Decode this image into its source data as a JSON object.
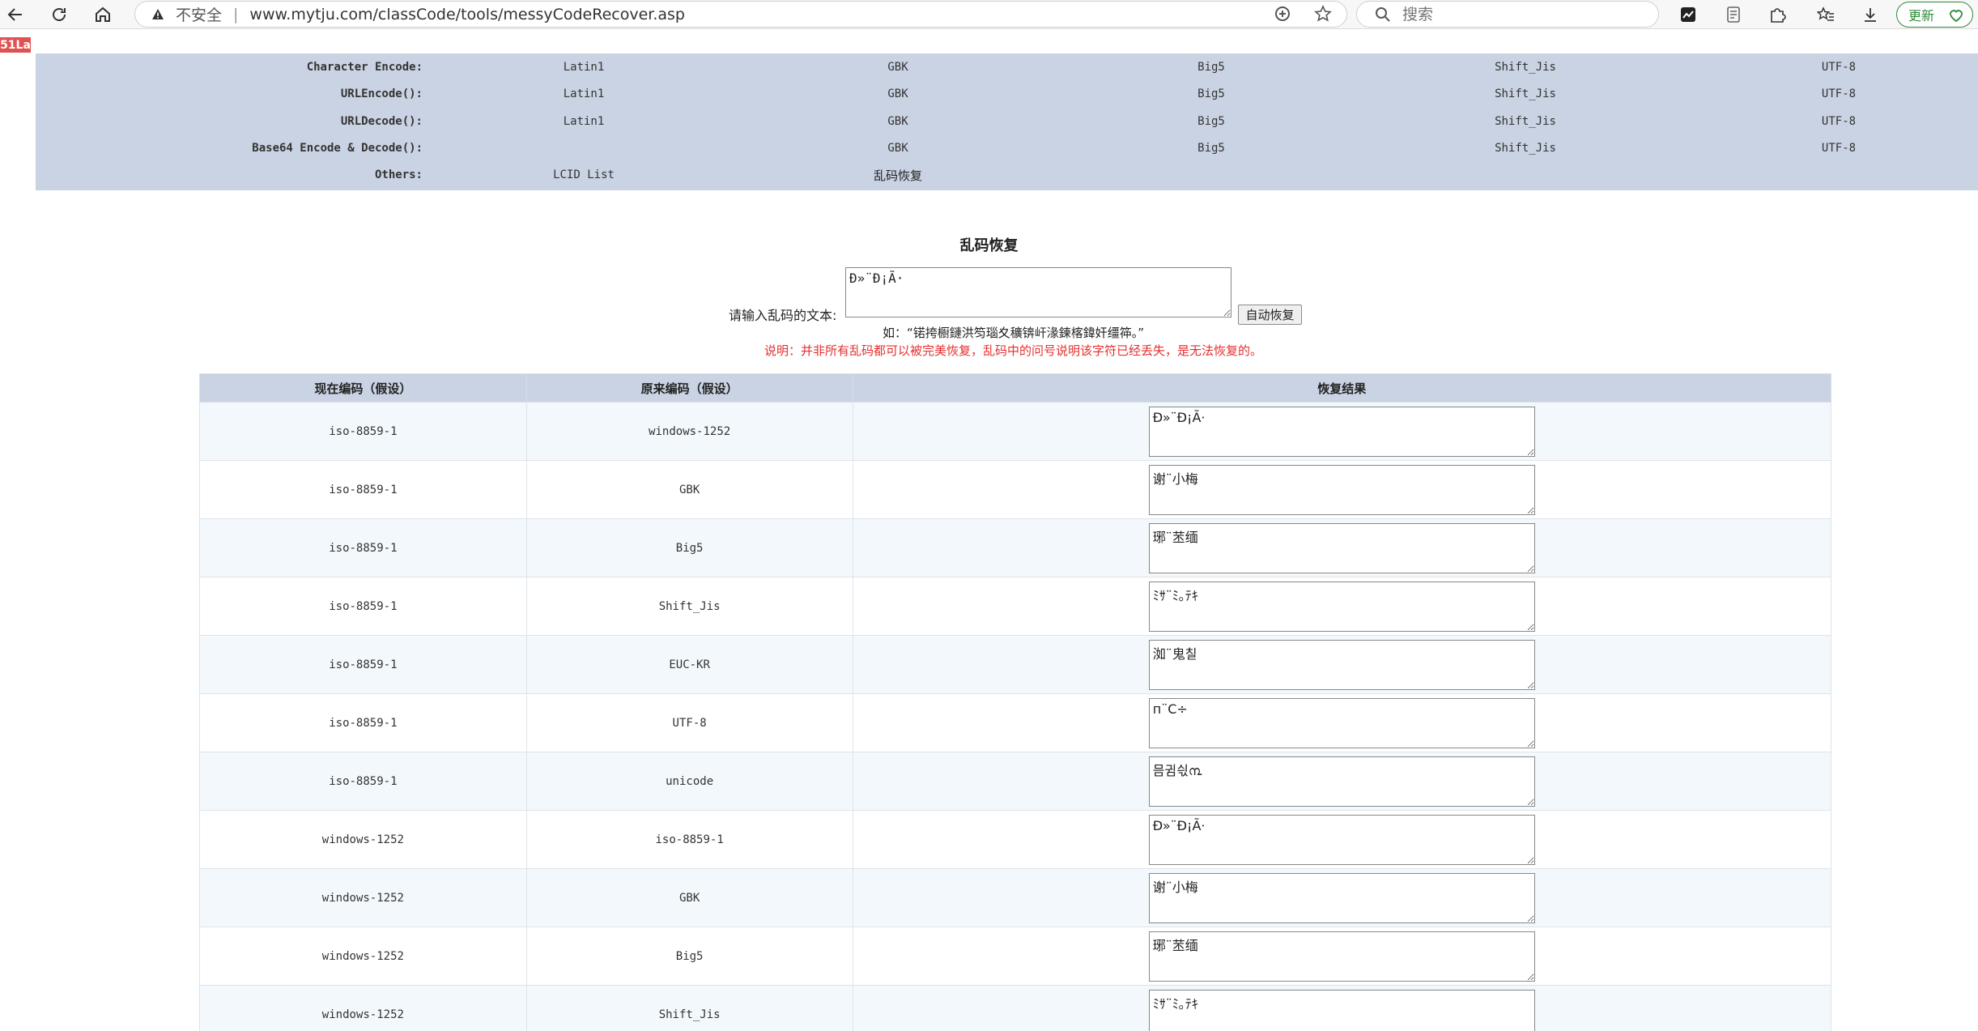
{
  "browser": {
    "insecure_label": "不安全",
    "separator": "|",
    "url": "www.mytju.com/classCode/tools/messyCodeRecover.asp",
    "search_placeholder": "搜索",
    "update_label": "更新"
  },
  "badge": "51La",
  "encode_nav": {
    "rows": [
      {
        "label": "Character Encode:",
        "cells": [
          "Latin1",
          "GBK",
          "Big5",
          "Shift_Jis",
          "UTF-8"
        ]
      },
      {
        "label": "URLEncode():",
        "cells": [
          "Latin1",
          "GBK",
          "Big5",
          "Shift_Jis",
          "UTF-8"
        ]
      },
      {
        "label": "URLDecode():",
        "cells": [
          "Latin1",
          "GBK",
          "Big5",
          "Shift_Jis",
          "UTF-8"
        ]
      },
      {
        "label": "Base64 Encode & Decode():",
        "cells": [
          "",
          "GBK",
          "Big5",
          "Shift_Jis",
          "UTF-8"
        ]
      },
      {
        "label": "Others:",
        "cells": [
          "LCID List",
          "乱码恢复",
          "",
          "",
          ""
        ]
      }
    ]
  },
  "tool": {
    "title": "乱码恢复",
    "input_label": "请输入乱码的文本:",
    "input_value": "Ð»¨Ð¡Ã·",
    "button_label": "自动恢复",
    "example": "如：“锘挎櫉鏈洪笉瑙夊穬锛屽湪鍊楁鍏奸缰筗。”",
    "note": "说明：并非所有乱码都可以被完美恢复，乱码中的问号说明该字符已经丢失，是无法恢复的。"
  },
  "results": {
    "headers": [
      "现在编码（假设）",
      "原来编码（假设）",
      "恢复结果"
    ],
    "rows": [
      {
        "current": "iso-8859-1",
        "original": "windows-1252",
        "result": "Ð»¨Ð¡Ã·"
      },
      {
        "current": "iso-8859-1",
        "original": "GBK",
        "result": "谢¨小梅"
      },
      {
        "current": "iso-8859-1",
        "original": "Big5",
        "result": "琊¨苤缅"
      },
      {
        "current": "iso-8859-1",
        "original": "Shift_Jis",
        "result": "ﾐｻ¨ﾐ｡ﾃｷ"
      },
      {
        "current": "iso-8859-1",
        "original": "EUC-KR",
        "result": "洳¨鬼칠"
      },
      {
        "current": "iso-8859-1",
        "original": "UTF-8",
        "result": "п¨С÷"
      },
      {
        "current": "iso-8859-1",
        "original": "unicode",
        "result": "믐귐싃൩"
      },
      {
        "current": "windows-1252",
        "original": "iso-8859-1",
        "result": "Ð»¨Ð¡Ã·"
      },
      {
        "current": "windows-1252",
        "original": "GBK",
        "result": "谢¨小梅"
      },
      {
        "current": "windows-1252",
        "original": "Big5",
        "result": "琊¨苤缅"
      },
      {
        "current": "windows-1252",
        "original": "Shift_Jis",
        "result": "ﾐｻ¨ﾐ｡ﾃｷ"
      }
    ]
  }
}
